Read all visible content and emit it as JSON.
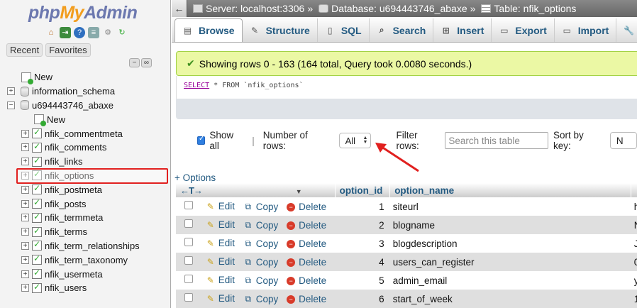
{
  "logo": {
    "php": "php",
    "my": "My",
    "admin": "Admin"
  },
  "nav_tabs": {
    "recent": "Recent",
    "favorites": "Favorites"
  },
  "tree": {
    "new_root": "New",
    "databases": [
      {
        "name": "information_schema",
        "expanded": false
      },
      {
        "name": "u694443746_abaxe",
        "expanded": true
      }
    ],
    "new_table": "New",
    "tables": [
      "nfik_commentmeta",
      "nfik_comments",
      "nfik_links",
      "nfik_options",
      "nfik_postmeta",
      "nfik_posts",
      "nfik_termmeta",
      "nfik_terms",
      "nfik_term_relationships",
      "nfik_term_taxonomy",
      "nfik_usermeta",
      "nfik_users"
    ],
    "selected_table": "nfik_options"
  },
  "breadcrumb": {
    "server": "Server: localhost:3306",
    "database": "Database: u694443746_abaxe",
    "table": "Table: nfik_options"
  },
  "menu_tabs": [
    {
      "label": "Browse",
      "icon": "browse-icon"
    },
    {
      "label": "Structure",
      "icon": "structure-icon"
    },
    {
      "label": "SQL",
      "icon": "sql-icon"
    },
    {
      "label": "Search",
      "icon": "search-icon"
    },
    {
      "label": "Insert",
      "icon": "insert-icon"
    },
    {
      "label": "Export",
      "icon": "export-icon"
    },
    {
      "label": "Import",
      "icon": "import-icon"
    }
  ],
  "result_message": "Showing rows 0 - 163 (164 total, Query took 0.0080 seconds.)",
  "sql": {
    "select": "SELECT",
    "rest": "* FROM",
    "table": "`nfik_options`"
  },
  "controls": {
    "show_all_label": "Show all",
    "show_all_checked": true,
    "num_rows_label": "Number of rows:",
    "num_rows_value": "All",
    "filter_label": "Filter rows:",
    "filter_placeholder": "Search this table",
    "sort_label": "Sort by key:",
    "sort_value": "N"
  },
  "options_link": "+ Options",
  "table": {
    "columns": [
      "option_id",
      "option_name"
    ],
    "actions": {
      "edit": "Edit",
      "copy": "Copy",
      "delete": "Delete"
    },
    "rows": [
      {
        "option_id": "1",
        "option_name": "siteurl",
        "value_fragment": "h"
      },
      {
        "option_id": "2",
        "option_name": "blogname",
        "value_fragment": "N"
      },
      {
        "option_id": "3",
        "option_name": "blogdescription",
        "value_fragment": "J"
      },
      {
        "option_id": "4",
        "option_name": "users_can_register",
        "value_fragment": "0"
      },
      {
        "option_id": "5",
        "option_name": "admin_email",
        "value_fragment": "y"
      },
      {
        "option_id": "6",
        "option_name": "start_of_week",
        "value_fragment": "1"
      }
    ]
  },
  "colors": {
    "accent": "#235a81",
    "highlight": "#e1201f",
    "success_bg": "#ebf8a4"
  }
}
